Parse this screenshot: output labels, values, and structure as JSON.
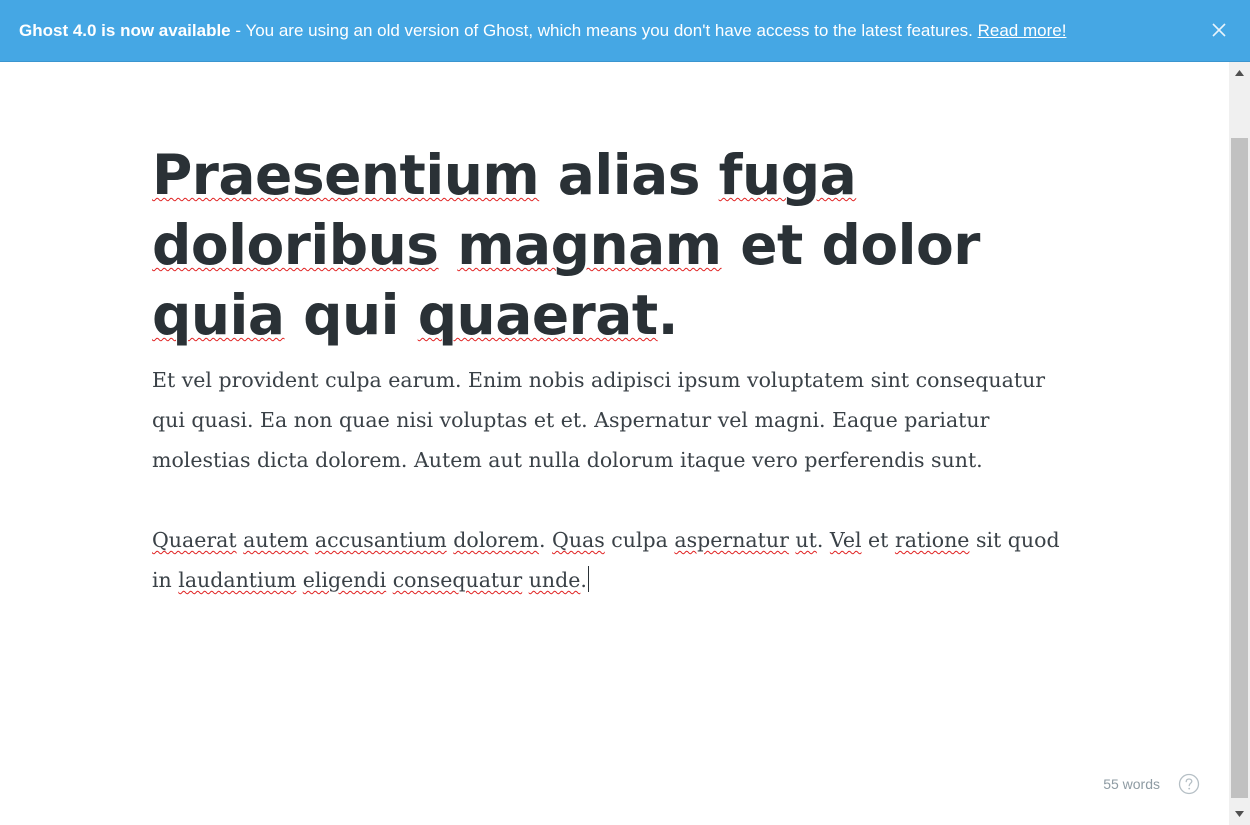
{
  "banner": {
    "headline": "Ghost 4.0 is now available",
    "message": " - You are using an old version of Ghost, which means you don't have access to the latest features. ",
    "link": "Read more!",
    "background": "#45a7e4",
    "close_icon": "close-icon"
  },
  "editor": {
    "title_words": [
      "Praesentium",
      " alias ",
      "fuga",
      " ",
      "doloribus",
      " ",
      "magnam",
      " et dolor ",
      "quia",
      " qui ",
      "quaerat",
      "."
    ],
    "paragraph1": "Et vel provident culpa earum. Enim nobis adipisci ipsum voluptatem sint consequatur qui quasi. Ea non quae nisi voluptas et et. Aspernatur vel magni. Eaque pariatur molestias dicta dolorem. Autem aut nulla dolorum itaque vero perferendis sunt.",
    "paragraph2_words": [
      "Quaerat",
      " ",
      "autem",
      " ",
      "accusantium",
      " ",
      "dolorem",
      ". ",
      "Quas",
      " culpa ",
      "aspernatur",
      " ",
      "ut",
      ". ",
      "Vel",
      " et ",
      "ratione",
      " sit quod in ",
      "laudantium",
      " ",
      "eligendi",
      " ",
      "consequatur",
      " ",
      "unde",
      "."
    ]
  },
  "footer": {
    "word_count": "55 words",
    "help_icon": "help-icon"
  }
}
